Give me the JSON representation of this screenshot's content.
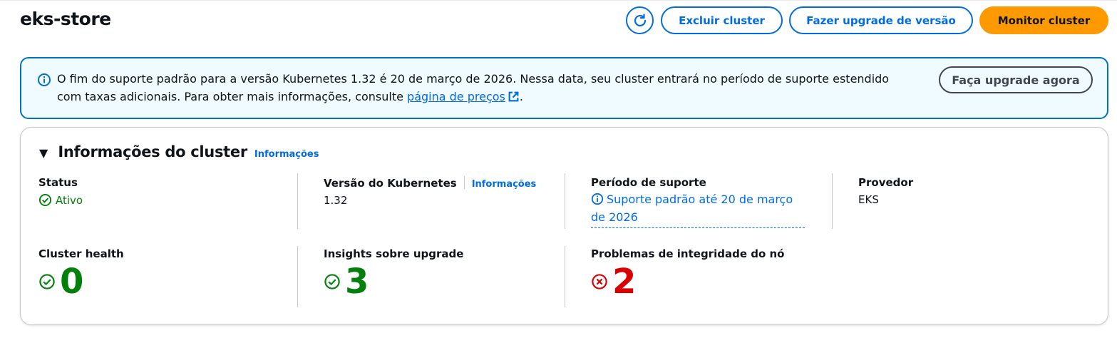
{
  "header": {
    "title": "eks-store",
    "delete_label": "Excluir cluster",
    "upgrade_label": "Fazer upgrade de versão",
    "monitor_label": "Monitor cluster"
  },
  "alert": {
    "text_before": "O fim do suporte padrão para a versão Kubernetes 1.32 é 20 de março de 2026. Nessa data, seu cluster entrará no período de suporte estendido com taxas adicionais. Para obter mais informações, consulte ",
    "link_text": "página de preços",
    "text_after": ".",
    "button_label": "Faça upgrade agora"
  },
  "cluster_info": {
    "title": "Informações do cluster",
    "info_link": "Informações",
    "status": {
      "label": "Status",
      "value": "Ativo"
    },
    "k8s_version": {
      "label": "Versão do Kubernetes",
      "info_link": "Informações",
      "value": "1.32"
    },
    "support_period": {
      "label": "Período de suporte",
      "value": "Suporte padrão até 20 de março de 2026"
    },
    "provider": {
      "label": "Provedor",
      "value": "EKS"
    },
    "cluster_health": {
      "label": "Cluster health",
      "value": "0"
    },
    "upgrade_insights": {
      "label": "Insights sobre upgrade",
      "value": "3"
    },
    "node_health_issues": {
      "label": "Problemas de integridade do nó",
      "value": "2"
    }
  },
  "colors": {
    "accent": "#006ce0",
    "primary_button": "#ff9900",
    "success": "#037f0c",
    "error": "#db0000",
    "alert_bg": "#f0fbff"
  },
  "icons": {
    "refresh": "refresh-icon",
    "info": "info-circle-icon",
    "external": "external-link-icon",
    "caret": "caret-down-icon",
    "success": "check-circle-icon",
    "error": "x-circle-icon"
  }
}
